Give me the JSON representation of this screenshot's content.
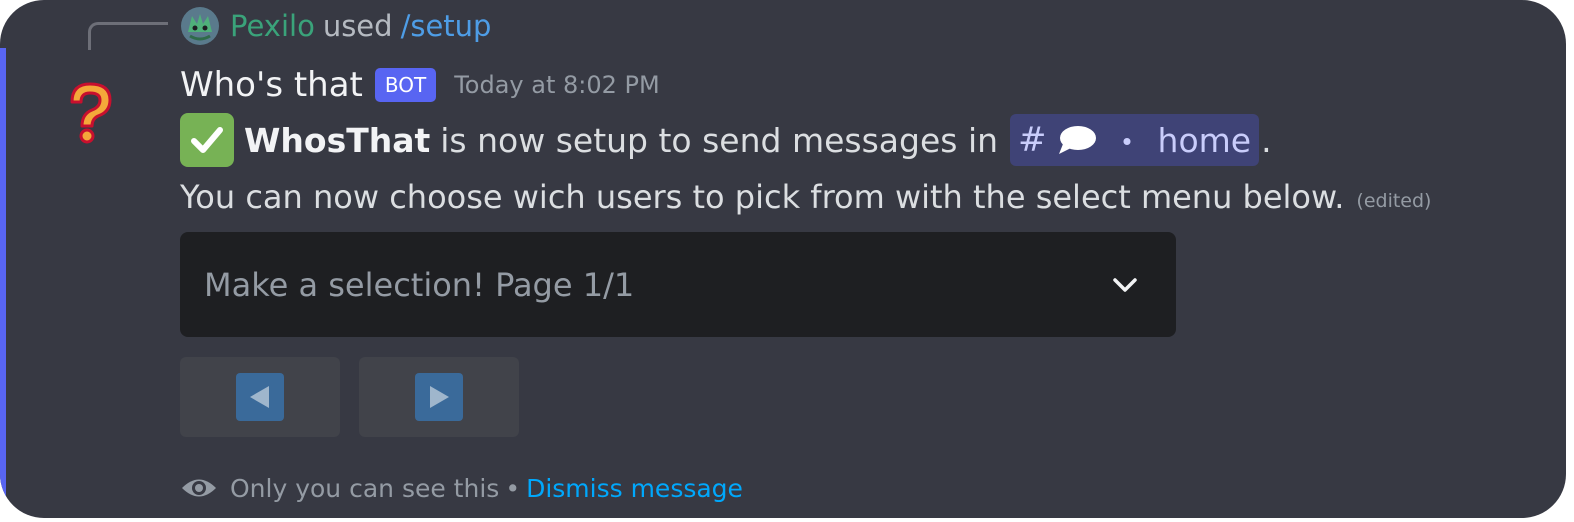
{
  "reply": {
    "username": "Pexilo",
    "used_text": "used",
    "command": "/setup"
  },
  "message": {
    "author": "Who's that",
    "bot_tag": "BOT",
    "timestamp": "Today at 8:02 PM",
    "bold_name": "WhosThat",
    "line1_text": "is now setup to send messages in",
    "channel_hash": "#",
    "channel_dot": "・",
    "channel_name": "home",
    "period": ".",
    "line2_text": "You can now choose wich users to pick from with the select menu below.",
    "edited_label": "(edited)"
  },
  "select_menu": {
    "placeholder": "Make a selection! Page 1/1"
  },
  "buttons": {
    "prev_icon": "arrow-left-icon",
    "next_icon": "arrow-right-icon"
  },
  "footer": {
    "visibility_text": "Only you can see this",
    "separator": "•",
    "dismiss_label": "Dismiss message"
  },
  "colors": {
    "background": "#373943",
    "accent": "#5865f2",
    "link": "#00a8fc",
    "reply_user": "#3aa37a",
    "command": "#4e9de6"
  }
}
